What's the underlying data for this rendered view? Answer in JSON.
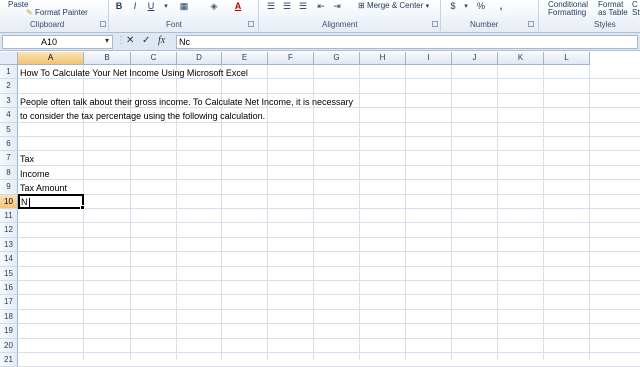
{
  "ribbon": {
    "clipboard": {
      "paste": "Paste",
      "format_painter": "Format Painter",
      "label": "Clipboard"
    },
    "font": {
      "bold": "B",
      "italic": "I",
      "underline": "U",
      "font_color": "A",
      "label": "Font"
    },
    "alignment": {
      "merge_center": "Merge & Center",
      "label": "Alignment"
    },
    "number": {
      "currency": "$",
      "percent": "%",
      "comma": ",",
      "label": "Number"
    },
    "styles": {
      "conditional": "Conditional",
      "conditional2": "Formatting",
      "format_as": "Format",
      "format_as2": "as Table",
      "cell_styles": "C",
      "cell_styles2": "Sty",
      "label": "Styles"
    }
  },
  "formula_bar": {
    "name_box": "A10",
    "cancel": "✕",
    "enter": "✓",
    "fx": "fx",
    "content": "Nc"
  },
  "sheet": {
    "columns": [
      "A",
      "B",
      "C",
      "D",
      "E",
      "F",
      "G",
      "H",
      "I",
      "J",
      "K",
      "L"
    ],
    "rows": [
      "1",
      "2",
      "3",
      "4",
      "5",
      "6",
      "7",
      "8",
      "9",
      "10",
      "11",
      "12",
      "13",
      "14",
      "15",
      "16",
      "17",
      "18",
      "19",
      "20",
      "21"
    ],
    "active_column": "A",
    "active_row": "10",
    "cells": {
      "A1": "How To Calculate Your Net Income Using Microsoft Excel",
      "A3": "People often talk about their gross income.  To Calculate Net Income, it is necessary",
      "A4": "to consider the tax percentage using the following calculation.",
      "A7": "Tax",
      "A8": "Income",
      "A9": "Tax Amount",
      "A10": "N"
    }
  }
}
